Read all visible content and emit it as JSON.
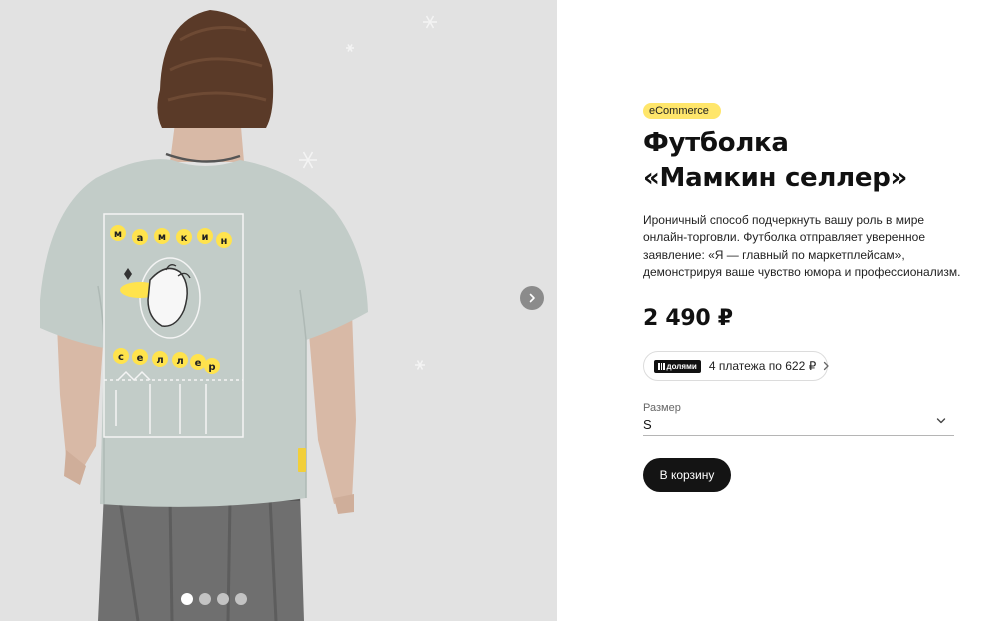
{
  "product": {
    "tag": "eCommerce",
    "title_line1": "Футболка",
    "title_line2": "«Мамкин селлер»",
    "description": "Ироничный способ подчеркнуть вашу роль в мире онлайн-торговли. Футболка отправляет уверенное заявление: «Я — главный по маркетплейсам», демонстрируя ваше чувство юмора и профессионализм.",
    "price": "2 490 ₽"
  },
  "installment": {
    "logo_text": "долями",
    "text": "4 платежа по 622 ₽"
  },
  "size": {
    "label": "Размер",
    "value": "S"
  },
  "cart_button": "В корзину",
  "gallery": {
    "slides_total": 4,
    "active_slide": 1,
    "print_top_word": "мамкин",
    "print_bottom_word": "селлер"
  },
  "colors": {
    "gallery_background": "#e2e2e2",
    "shirt": "#c2ccc8",
    "accent_yellow": "#ffe66b",
    "button_dark": "#141414"
  },
  "icons": {
    "next": "chevron-right-icon",
    "size_dropdown": "chevron-down-icon",
    "installment_arrow": "chevron-right-icon"
  }
}
